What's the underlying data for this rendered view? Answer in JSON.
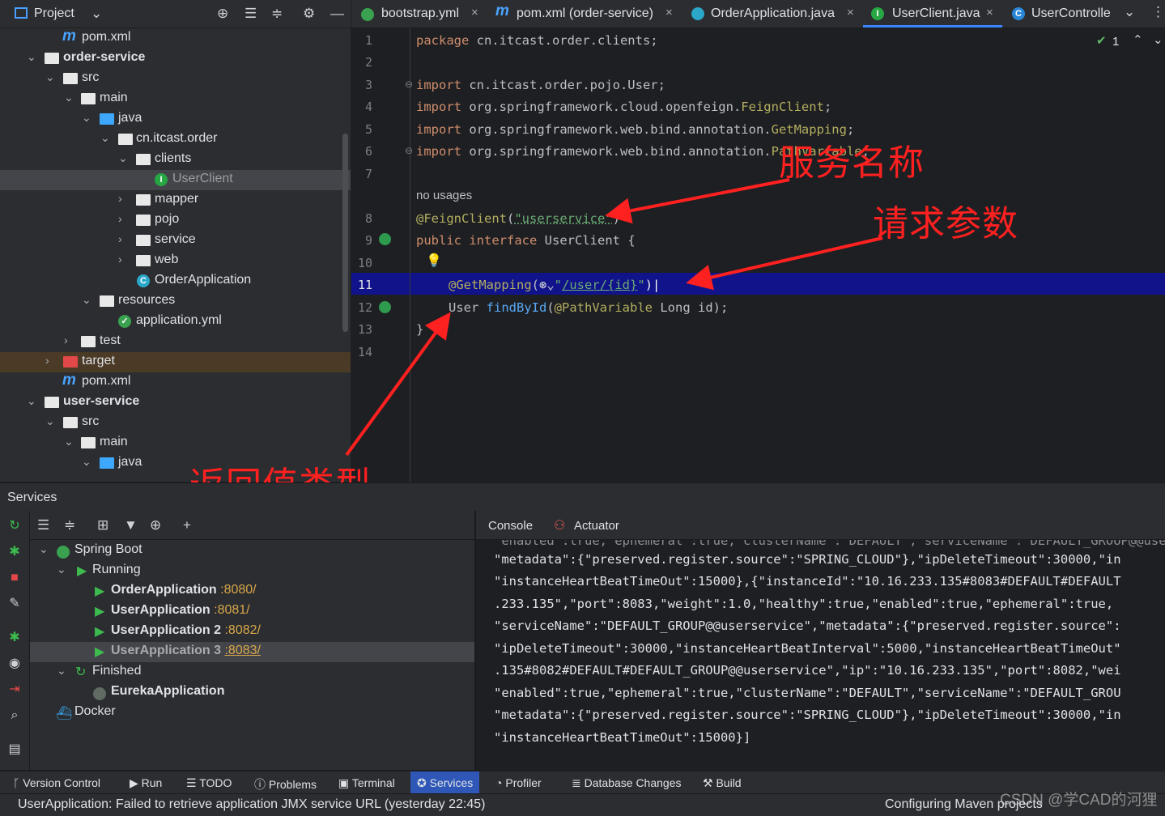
{
  "project_panel": {
    "title": "Project",
    "tree": [
      {
        "label": "pom.xml",
        "icon": "maven-icon"
      },
      {
        "label": "order-service",
        "icon": "module-folder-icon"
      },
      {
        "label": "src",
        "icon": "folder-icon"
      },
      {
        "label": "main",
        "icon": "folder-icon"
      },
      {
        "label": "java",
        "icon": "source-folder-icon"
      },
      {
        "label": "cn.itcast.order",
        "icon": "package-icon"
      },
      {
        "label": "clients",
        "icon": "package-icon"
      },
      {
        "label": "UserClient",
        "icon": "interface-icon",
        "selected": true
      },
      {
        "label": "mapper",
        "icon": "package-icon"
      },
      {
        "label": "pojo",
        "icon": "package-icon"
      },
      {
        "label": "service",
        "icon": "package-icon"
      },
      {
        "label": "web",
        "icon": "package-icon"
      },
      {
        "label": "OrderApplication",
        "icon": "spring-class-icon"
      },
      {
        "label": "resources",
        "icon": "resources-folder-icon"
      },
      {
        "label": "application.yml",
        "icon": "yaml-icon"
      },
      {
        "label": "test",
        "icon": "folder-icon"
      },
      {
        "label": "target",
        "icon": "excluded-folder-icon"
      },
      {
        "label": "pom.xml",
        "icon": "maven-icon"
      },
      {
        "label": "user-service",
        "icon": "module-folder-icon"
      },
      {
        "label": "src",
        "icon": "folder-icon"
      },
      {
        "label": "main",
        "icon": "folder-icon"
      },
      {
        "label": "java",
        "icon": "source-folder-icon"
      }
    ]
  },
  "editor": {
    "tabs": [
      {
        "label": "bootstrap.yml",
        "icon": "yaml-icon"
      },
      {
        "label": "pom.xml (order-service)",
        "icon": "maven-icon"
      },
      {
        "label": "OrderApplication.java",
        "icon": "spring-class-icon"
      },
      {
        "label": "UserClient.java",
        "icon": "interface-icon",
        "active": true
      },
      {
        "label": "UserControlle",
        "icon": "class-icon"
      }
    ],
    "inspection_count": "1",
    "line_numbers": [
      "1",
      "2",
      "3",
      "4",
      "5",
      "6",
      "7",
      "8",
      "9",
      "10",
      "11",
      "12",
      "13",
      "14"
    ],
    "usage_hint": "no usages",
    "code": {
      "l1_kw": "package",
      "l1_rest": " cn.itcast.order.clients;",
      "l3_kw": "import",
      "l3_rest": " cn.itcast.order.pojo.User;",
      "l4_kw": "import",
      "l4_rest": " org.springframework.cloud.openfeign.",
      "l4_cls": "FeignClient",
      "l5_kw": "import",
      "l5_rest": " org.springframework.web.bind.annotation.",
      "l5_cls": "GetMapping",
      "l6_kw": "import",
      "l6_rest": " org.springframework.web.bind.annotation.",
      "l6_cls": "PathVariable",
      "l8_an": "@FeignClient",
      "l8_open": "(",
      "l8_str": "\"userservice\"",
      "l8_close": ")",
      "l9_kw1": "public",
      "l9_kw2": "interface",
      "l9_rest": " UserClient {",
      "l11_an": "@GetMapping",
      "l11_open": "(",
      "l11_q1": "\"",
      "l11_url": "/user/{id}",
      "l11_q2": "\"",
      "l11_close": ")",
      "l12_type": "User ",
      "l12_fn": "findById",
      "l12_open": "(",
      "l12_an": "@PathVariable",
      "l12_rest": " Long id);",
      "l13": "}"
    }
  },
  "annotations": {
    "service_name": "服务名称",
    "request_params": "请求参数",
    "return_type": "返回值类型",
    "color": "#ff2020"
  },
  "services_panel": {
    "title": "Services",
    "tree": {
      "spring_boot": "Spring Boot",
      "running": "Running",
      "apps": [
        {
          "name": "OrderApplication",
          "port": ":8080/"
        },
        {
          "name": "UserApplication",
          "port": ":8081/"
        },
        {
          "name": "UserApplication 2",
          "port": ":8082/"
        },
        {
          "name": "UserApplication 3",
          "port": ":8083/",
          "selected": true
        }
      ],
      "finished": "Finished",
      "eureka": "EurekaApplication",
      "docker": "Docker"
    },
    "console_tabs": [
      "Console",
      "Actuator"
    ],
    "console_lines": [
      "\"metadata\":{\"preserved.register.source\":\"SPRING_CLOUD\"},\"ipDeleteTimeout\":30000,\"in",
      "\"instanceHeartBeatTimeOut\":15000},{\"instanceId\":\"10.16.233.135#8083#DEFAULT#DEFAULT",
      ".233.135\",\"port\":8083,\"weight\":1.0,\"healthy\":true,\"enabled\":true,\"ephemeral\":true,",
      "\"serviceName\":\"DEFAULT_GROUP@@userservice\",\"metadata\":{\"preserved.register.source\":",
      "\"ipDeleteTimeout\":30000,\"instanceHeartBeatInterval\":5000,\"instanceHeartBeatTimeOut\"",
      ".135#8082#DEFAULT#DEFAULT_GROUP@@userservice\",\"ip\":\"10.16.233.135\",\"port\":8082,\"wei",
      "\"enabled\":true,\"ephemeral\":true,\"clusterName\":\"DEFAULT\",\"serviceName\":\"DEFAULT_GROU",
      "\"metadata\":{\"preserved.register.source\":\"SPRING_CLOUD\"},\"ipDeleteTimeout\":30000,\"in",
      "\"instanceHeartBeatTimeOut\":15000}]"
    ]
  },
  "tool_windows": [
    "Version Control",
    "Run",
    "TODO",
    "Problems",
    "Terminal",
    "Services",
    "Profiler",
    "Database Changes",
    "Build"
  ],
  "active_tool_window": "Services",
  "status": {
    "message": "UserApplication: Failed to retrieve application JMX service URL (yesterday 22:45)",
    "progress": "Configuring Maven projects"
  },
  "watermark": "CSDN @学CAD的河狸"
}
